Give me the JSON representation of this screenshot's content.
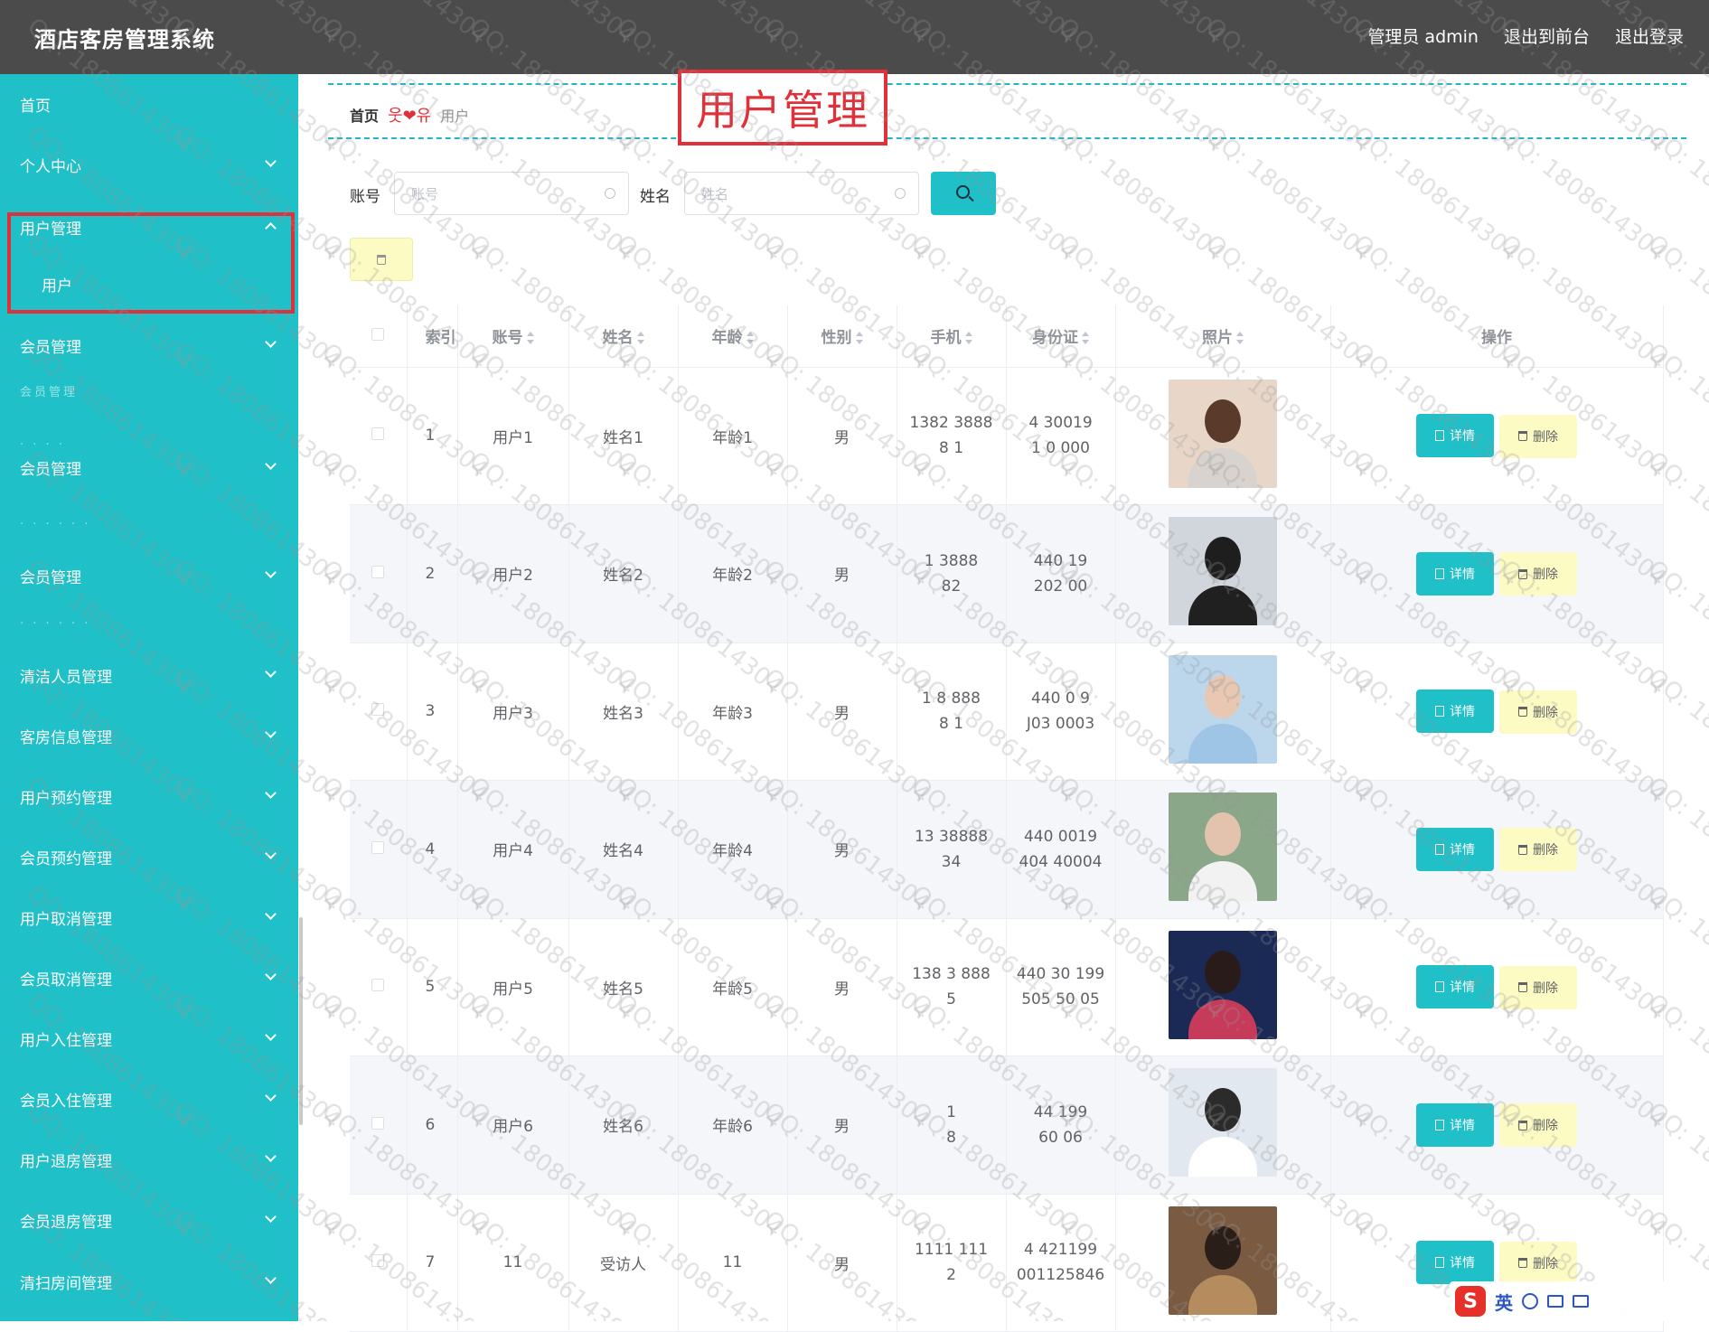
{
  "header": {
    "app_title": "酒店客房管理系统",
    "admin_label": "管理员 admin",
    "to_frontend": "退出到前台",
    "logout": "退出登录"
  },
  "sidebar": {
    "home": "首页",
    "personal_center": "个人中心",
    "user_mgmt": "用户管理",
    "user_sub": "用户",
    "member_mgmt_1": "会员管理",
    "faint_1": "会员管理",
    "faint_2": "·  ·  ·  ·",
    "member_mgmt_2": "会员管理",
    "faint_3": "·  ·  ·  ·       ·  ·",
    "member_mgmt_3": "会员管理",
    "faint_4": "·  ·  ·  ·       ·  ·",
    "cleaner_mgmt": "清洁人员管理",
    "room_info_mgmt": "客房信息管理",
    "user_booking_mgmt": "用户预约管理",
    "member_booking_mgmt": "会员预约管理",
    "user_cancel_mgmt": "用户取消管理",
    "member_cancel_mgmt": "会员取消管理",
    "user_checkin_mgmt": "用户入住管理",
    "member_checkin_mgmt": "会员入住管理",
    "user_checkout_mgmt": "用户退房管理",
    "member_checkout_mgmt": "会员退房管理",
    "cleaning_room_mgmt": "清扫房间管理"
  },
  "breadcrumb": {
    "home": "首页",
    "separator": "웃❤유",
    "current": "用户"
  },
  "page_title": "用户管理",
  "search": {
    "account_label": "账号",
    "account_placeholder": "账号",
    "name_label": "姓名",
    "name_placeholder": "姓名"
  },
  "table": {
    "headers": [
      "索引",
      "账号",
      "姓名",
      "年龄",
      "性别",
      "手机",
      "身份证",
      "照片",
      "操作"
    ],
    "detail_label": "详情",
    "delete_label": "删除",
    "rows": [
      {
        "index": "1",
        "account": "用户1",
        "name": "姓名1",
        "age": "年龄1",
        "gender": "男",
        "phone_1": "1382  3888",
        "phone_2": "8 1",
        "id_1": "4   30019",
        "id_2": "1   0  000"
      },
      {
        "index": "2",
        "account": "用户2",
        "name": "姓名2",
        "age": "年龄2",
        "gender": "男",
        "phone_1": "1   3888",
        "phone_2": "82",
        "id_1": "440   19",
        "id_2": "202    00"
      },
      {
        "index": "3",
        "account": "用户3",
        "name": "姓名3",
        "age": "年龄3",
        "gender": "男",
        "phone_1": "1  8    888",
        "phone_2": "8  1",
        "id_1": "440   0  9",
        "id_2": "J03    0003"
      },
      {
        "index": "4",
        "account": "用户4",
        "name": "姓名4",
        "age": "年龄4",
        "gender": "男",
        "phone_1": "13   38888",
        "phone_2": "34",
        "id_1": "440   0019",
        "id_2": "404  40004"
      },
      {
        "index": "5",
        "account": "用户5",
        "name": "姓名5",
        "age": "年龄5",
        "gender": "男",
        "phone_1": "138  3  888",
        "phone_2": "5",
        "id_1": "440 30  199",
        "id_2": "505  50  05"
      },
      {
        "index": "6",
        "account": "用户6",
        "name": "姓名6",
        "age": "年龄6",
        "gender": "男",
        "phone_1": "1        ",
        "phone_2": "8",
        "id_1": "44     199",
        "id_2": "60      06"
      },
      {
        "index": "7",
        "account": "11",
        "name": "受访人",
        "age": "11",
        "gender": "男",
        "phone_1": "1111   111",
        "phone_2": "2",
        "id_1": "4   421199",
        "id_2": "001125846"
      }
    ]
  },
  "watermark_text": "QQ: 1808614304",
  "ime": {
    "logo": "S",
    "mode": "英"
  },
  "colors": {
    "sidebar_bg": "#20c0c8",
    "header_bg": "#4b4b4b",
    "accent": "#20c0c8",
    "highlight_red": "#e0303a",
    "delete_bg": "#fdfbc4"
  },
  "icons": [
    "search-icon",
    "delete-icon",
    "document-icon",
    "trash-icon",
    "chevron-down-icon",
    "chevron-up-icon",
    "sort-icon"
  ]
}
